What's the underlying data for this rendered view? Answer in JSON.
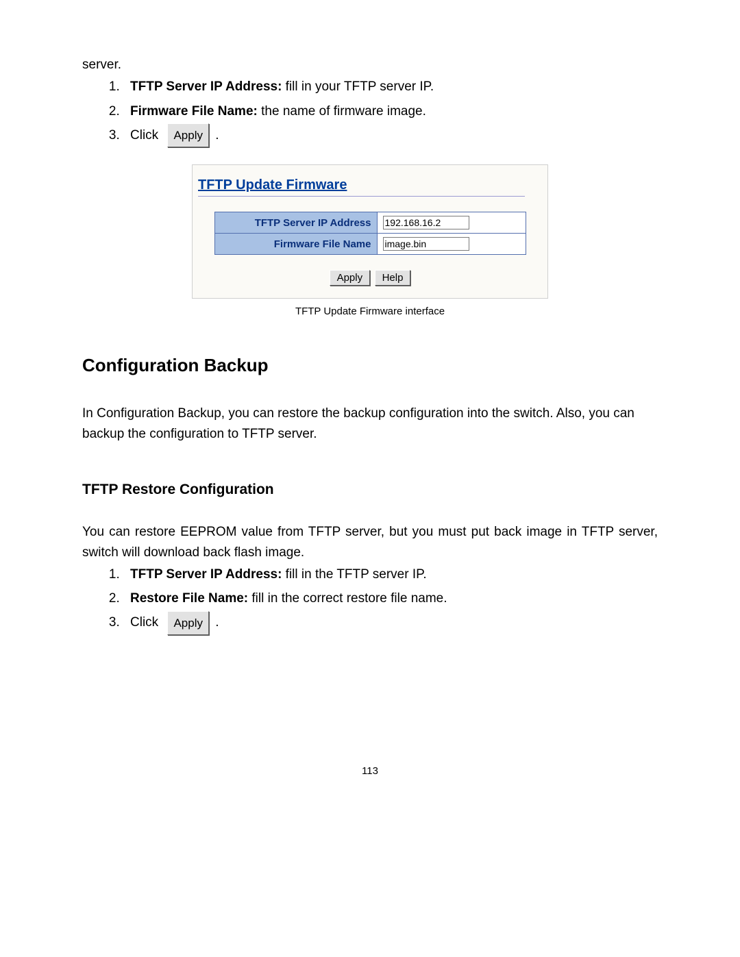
{
  "intro_continuation": "server.",
  "list1": {
    "item1_bold": "TFTP Server IP Address:",
    "item1_rest": " fill in your TFTP server IP.",
    "item2_bold": "Firmware File Name:",
    "item2_rest": " the name of firmware image.",
    "item3_prefix": "Click ",
    "item3_btn": "Apply",
    "item3_suffix": " ."
  },
  "figure": {
    "title": "TFTP Update Firmware",
    "row1_label": "TFTP Server IP Address",
    "row1_value": "192.168.16.2",
    "row2_label": "Firmware File Name",
    "row2_value": "image.bin",
    "btn_apply": "Apply",
    "btn_help": "Help",
    "caption": "TFTP Update Firmware interface"
  },
  "section2": {
    "heading": "Configuration Backup",
    "para": "In Configuration Backup, you can restore the backup configuration into the switch. Also, you can backup the configuration to TFTP server."
  },
  "section3": {
    "heading": "TFTP Restore Configuration",
    "para": "You can restore EEPROM value from TFTP server, but you must put back image in TFTP server, switch will download back flash image.",
    "list": {
      "item1_bold": "TFTP Server IP Address:",
      "item1_rest": " fill in the TFTP server IP.",
      "item2_bold": "Restore File Name:",
      "item2_rest": " fill in the correct restore file name.",
      "item3_prefix": "Click ",
      "item3_btn": "Apply",
      "item3_suffix": " ."
    }
  },
  "page_number": "113"
}
